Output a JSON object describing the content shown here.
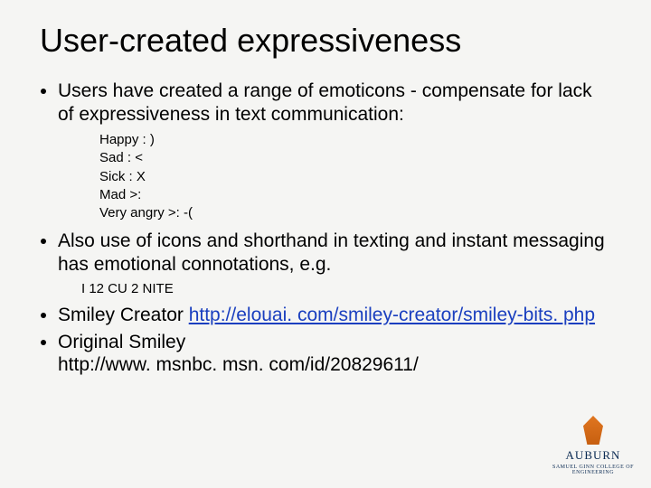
{
  "title": "User-created expressiveness",
  "bullets": {
    "b1": "Users have created a range of emoticons - compensate for lack of expressiveness in text communication:",
    "emoticons": {
      "l1": "Happy  : )",
      "l2": "Sad  : <",
      "l3": "Sick : X",
      "l4": "Mad  >:",
      "l5": "Very angry >: -("
    },
    "b2": "Also use of icons and shorthand in texting and instant messaging has emotional connotations, e.g.",
    "shorthand": "I 12 CU 2 NITE",
    "b3_pre": "Smiley Creator ",
    "b3_link": "http://elouai. com/smiley-creator/smiley-bits. php",
    "b4_pre": "Original Smiley ",
    "b4_link": "http://www. msnbc. msn. com/id/20829611/"
  },
  "logo": {
    "name": "AUBURN",
    "sub": "SAMUEL GINN COLLEGE OF ENGINEERING"
  }
}
